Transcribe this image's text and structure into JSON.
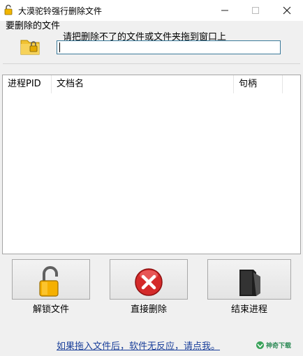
{
  "window": {
    "title": "大漠驼铃强行删除文件",
    "icon": "lock-icon",
    "controls": [
      "minimize",
      "maximize",
      "close"
    ]
  },
  "file_section": {
    "label": "要删除的文件",
    "hint": "请把删除不了的文件或文件夹拖到窗口上",
    "path_value": "",
    "icon": "folder-lock-icon"
  },
  "process_table": {
    "columns": [
      "进程PID",
      "文档名",
      "句柄"
    ],
    "rows": []
  },
  "actions": {
    "unlock_label": "解锁文件",
    "delete_label": "直接删除",
    "kill_label": "结束进程"
  },
  "footer": {
    "link_text": "如果拖入文件后，软件无反应，请点我。",
    "logo_text": "神奇下载"
  },
  "colors": {
    "accent_link": "#1a3f9a",
    "delete_red": "#d42a2a",
    "lock_gold": "#f0a800"
  }
}
